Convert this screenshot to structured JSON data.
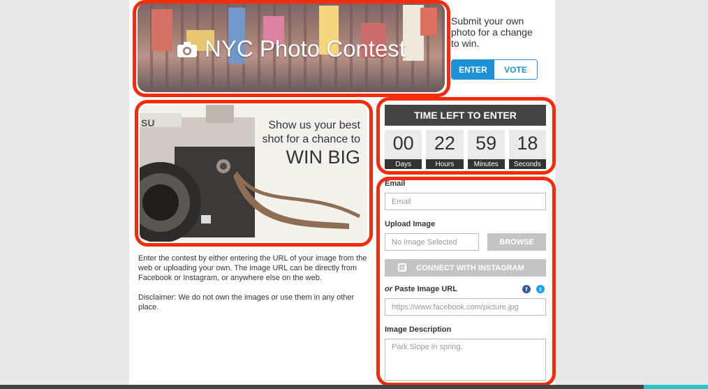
{
  "banner": {
    "title": "NYC Photo Contest",
    "icon": "camera-icon"
  },
  "submit": {
    "text": "Submit your own photo for a change to win.",
    "toggle": {
      "enter": "ENTER",
      "vote": "VOTE",
      "active": "enter"
    }
  },
  "promo": {
    "line1": "Show us your best",
    "line2": "shot for a chance to",
    "line3": "WIN BIG"
  },
  "description": {
    "paragraph1": "Enter the contest by either entering the URL of your image from the web or uploading your own. The image URL can be directly from Facebook or Instagram, or anywhere else on the web.",
    "paragraph2": "Disclaimer: We do not own the images or use them in any other place."
  },
  "timer": {
    "title": "TIME LEFT TO ENTER",
    "cells": [
      {
        "value": "00",
        "label": "Days"
      },
      {
        "value": "22",
        "label": "Hours"
      },
      {
        "value": "59",
        "label": "Minutes"
      },
      {
        "value": "18",
        "label": "Seconds"
      }
    ]
  },
  "form": {
    "email_label": "Email",
    "email_placeholder": "Email",
    "upload_label": "Upload Image",
    "upload_placeholder": "No Image Selected",
    "browse_label": "BROWSE",
    "instagram_label": "CONNECT WITH INSTAGRAM",
    "url_label_prefix": "or",
    "url_label": "Paste Image URL",
    "url_placeholder": "https://www.facebook.com/picture.jpg",
    "desc_label": "Image Description",
    "desc_placeholder": "Park Slope in spring."
  },
  "colors": {
    "accent": "#1e90d6",
    "highlight": "#f22c0c",
    "timer_bg": "#444444",
    "facebook": "#3b5998",
    "twitter": "#1da1f2"
  }
}
